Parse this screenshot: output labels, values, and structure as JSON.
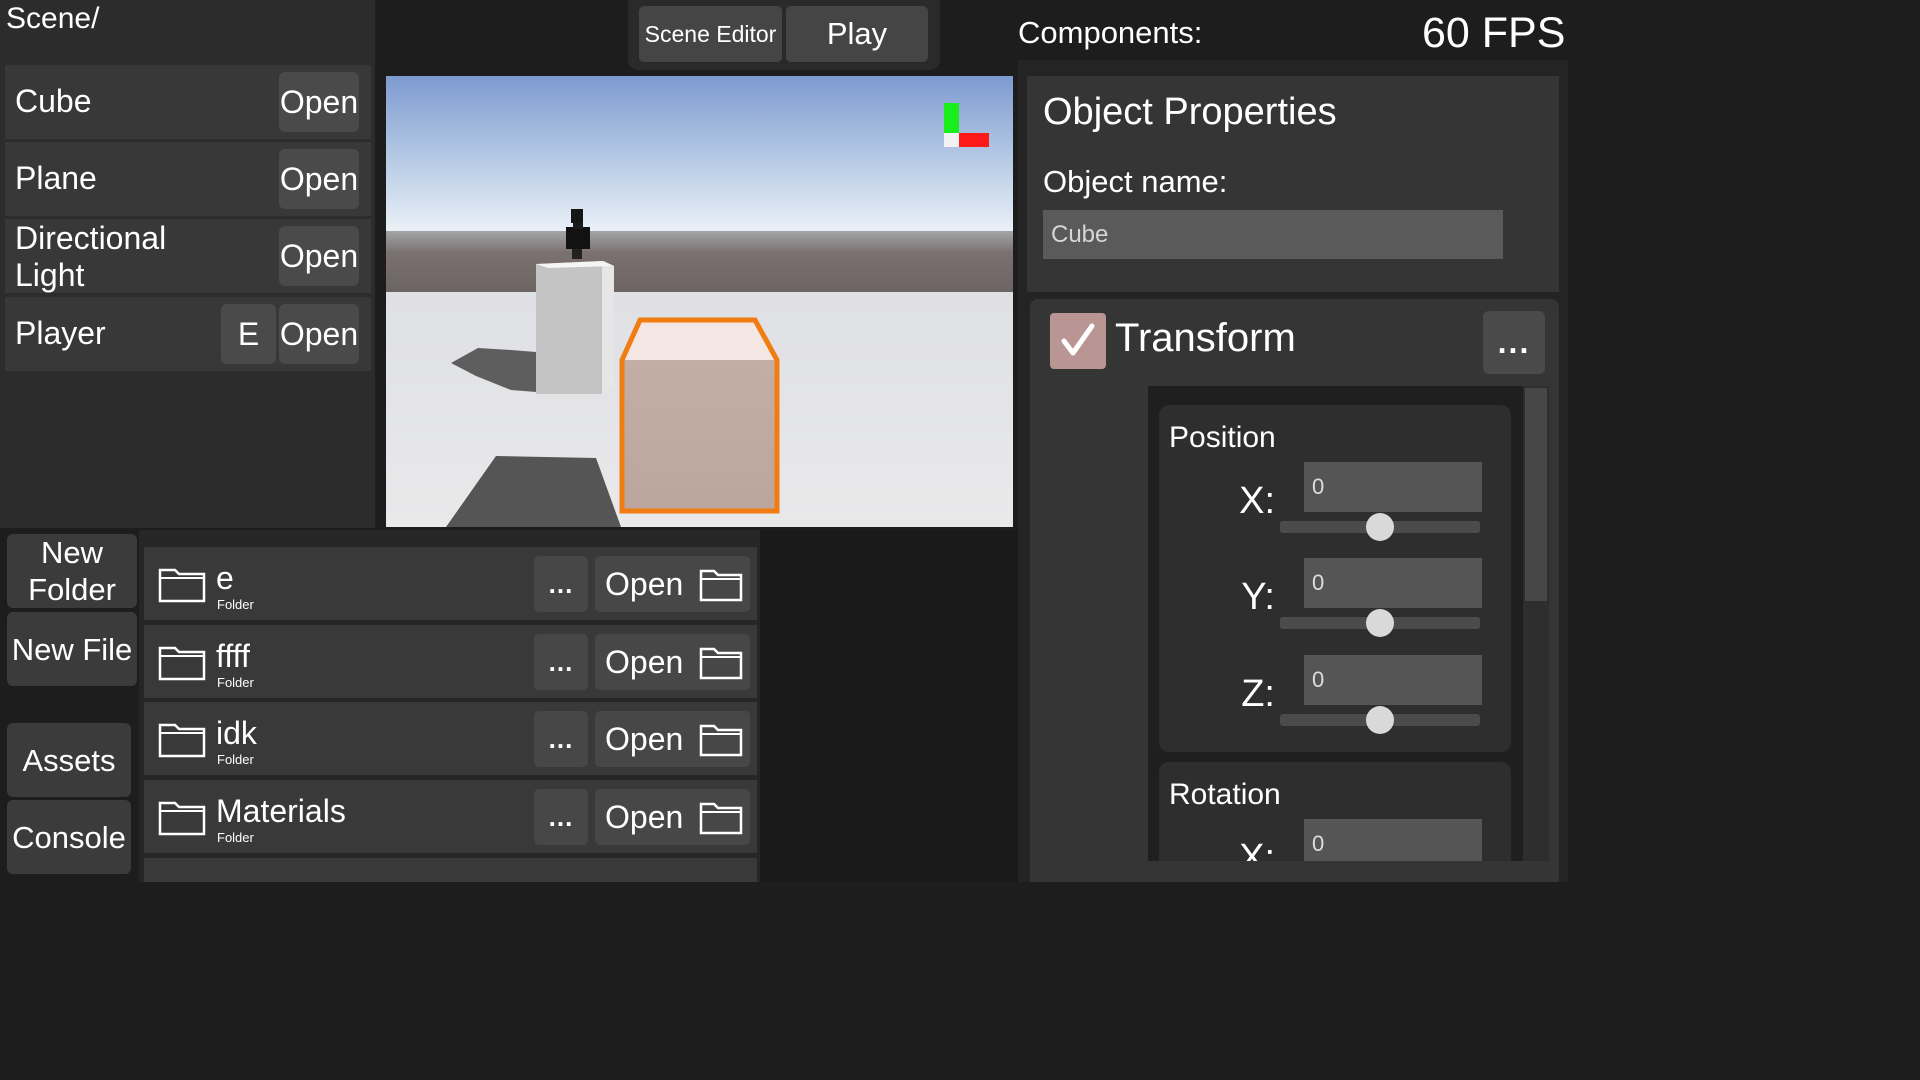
{
  "hierarchy": {
    "path": "Scene/",
    "items": [
      {
        "label": "Cube",
        "open": "Open"
      },
      {
        "label": "Plane",
        "open": "Open"
      },
      {
        "label": "Directional Light",
        "open": "Open"
      },
      {
        "label": "Player",
        "extra": "E",
        "open": "Open"
      }
    ]
  },
  "toolbar": {
    "scene_editor": "Scene Editor",
    "play": "Play"
  },
  "components": {
    "title": "Components:",
    "fps": "60 FPS",
    "object_properties": {
      "title": "Object Properties",
      "name_label": "Object name:",
      "name_value": "Cube"
    },
    "transform": {
      "title": "Transform",
      "menu": "...",
      "enabled": true,
      "position": {
        "title": "Position",
        "x_label": "X:",
        "x_value": "0",
        "y_label": "Y:",
        "y_value": "0",
        "z_label": "Z:",
        "z_value": "0"
      },
      "rotation": {
        "title": "Rotation",
        "x_label": "X:",
        "x_value": "0"
      }
    }
  },
  "sidebar_buttons": {
    "new_folder": "New Folder",
    "new_file": "New File",
    "assets": "Assets",
    "console": "Console"
  },
  "files": [
    {
      "name": "e",
      "type": "Folder",
      "menu": "...",
      "open": "Open"
    },
    {
      "name": "ffff",
      "type": "Folder",
      "menu": "...",
      "open": "Open"
    },
    {
      "name": "idk",
      "type": "Folder",
      "menu": "...",
      "open": "Open"
    },
    {
      "name": "Materials",
      "type": "Folder",
      "menu": "...",
      "open": "Open"
    }
  ],
  "colors": {
    "selection_outline": "#f07c12",
    "axis_gizmo_x": "#ff1a1a",
    "axis_gizmo_y": "#1aee1a",
    "transform_check": "#b99694"
  }
}
